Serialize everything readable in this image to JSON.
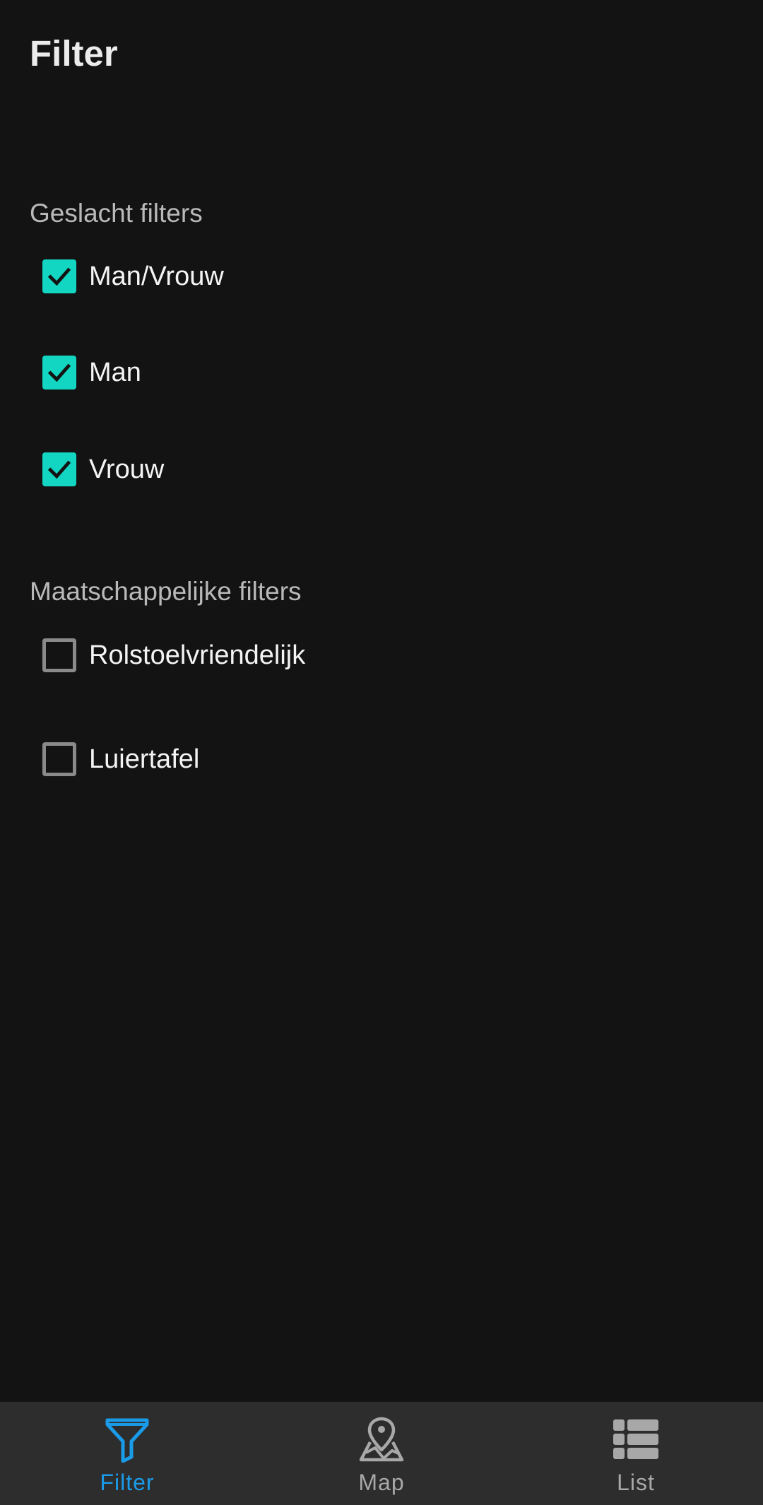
{
  "page": {
    "title": "Filter"
  },
  "sections": [
    {
      "header": "Geslacht filters",
      "options": [
        {
          "label": "Man/Vrouw",
          "checked": true
        },
        {
          "label": "Man",
          "checked": true
        },
        {
          "label": "Vrouw",
          "checked": true
        }
      ]
    },
    {
      "header": "Maatschappelijke filters",
      "options": [
        {
          "label": "Rolstoelvriendelijk",
          "checked": false
        },
        {
          "label": "Luiertafel",
          "checked": false
        }
      ]
    }
  ],
  "bottom_nav": {
    "items": [
      {
        "label": "Filter",
        "icon": "funnel-icon",
        "active": true
      },
      {
        "label": "Map",
        "icon": "map-pin-icon",
        "active": false
      },
      {
        "label": "List",
        "icon": "list-icon",
        "active": false
      }
    ]
  },
  "colors": {
    "background": "#131313",
    "checkbox_checked": "#12d6c1",
    "checkbox_unchecked_border": "#8a8a8a",
    "nav_background": "#2d2d2d",
    "nav_active": "#1a9be8",
    "nav_inactive": "#a8a8a8"
  }
}
